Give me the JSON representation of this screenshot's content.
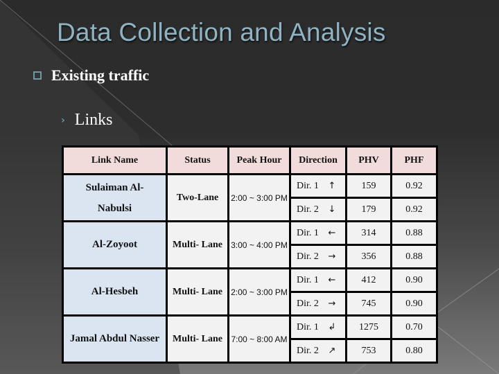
{
  "slide": {
    "title": "Data Collection and Analysis",
    "bullet_level1": "Existing traffic",
    "bullet_level2": "Links"
  },
  "table": {
    "headers": [
      "Link Name",
      "Status",
      "Peak Hour",
      "Direction",
      "PHV",
      "PHF"
    ],
    "rows": [
      {
        "link_name_line1": "Sulaiman Al-",
        "link_name_line2": "Nabulsi",
        "status": "Two-Lane",
        "peak_hour": "2:00 ~ 3:00 PM",
        "directions": [
          {
            "label": "Dir. 1",
            "arrow": "↑",
            "arrow_icon": "arrow-up-icon",
            "phv": "159",
            "phf": "0.92"
          },
          {
            "label": "Dir. 2",
            "arrow": "↓",
            "arrow_icon": "arrow-down-icon",
            "phv": "179",
            "phf": "0.92"
          }
        ]
      },
      {
        "link_name_line1": "Al-Zoyoot",
        "link_name_line2": "",
        "status": "Multi- Lane",
        "peak_hour": "3:00 ~ 4:00 PM",
        "directions": [
          {
            "label": "Dir. 1",
            "arrow": "←",
            "arrow_icon": "arrow-left-icon",
            "phv": "314",
            "phf": "0.88"
          },
          {
            "label": "Dir. 2",
            "arrow": "→",
            "arrow_icon": "arrow-right-icon",
            "phv": "356",
            "phf": "0.88"
          }
        ]
      },
      {
        "link_name_line1": "Al-Hesbeh",
        "link_name_line2": "",
        "status": "Multi- Lane",
        "peak_hour": "2:00 ~ 3:00 PM",
        "directions": [
          {
            "label": "Dir. 1",
            "arrow": "←",
            "arrow_icon": "arrow-left-icon",
            "phv": "412",
            "phf": "0.90"
          },
          {
            "label": "Dir. 2",
            "arrow": "→",
            "arrow_icon": "arrow-right-icon",
            "phv": "745",
            "phf": "0.90"
          }
        ]
      },
      {
        "link_name_line1": "Jamal Abdul Nasser",
        "link_name_line2": "",
        "status": "Multi- Lane",
        "peak_hour": "7:00 ~ 8:00 AM",
        "directions": [
          {
            "label": "Dir. 1",
            "arrow": "↲",
            "arrow_icon": "arrow-down-left-turn-icon",
            "phv": "1275",
            "phf": "0.70"
          },
          {
            "label": "Dir. 2",
            "arrow": "↗",
            "arrow_icon": "arrow-up-right-turn-icon",
            "phv": "753",
            "phf": "0.80"
          }
        ]
      }
    ]
  }
}
